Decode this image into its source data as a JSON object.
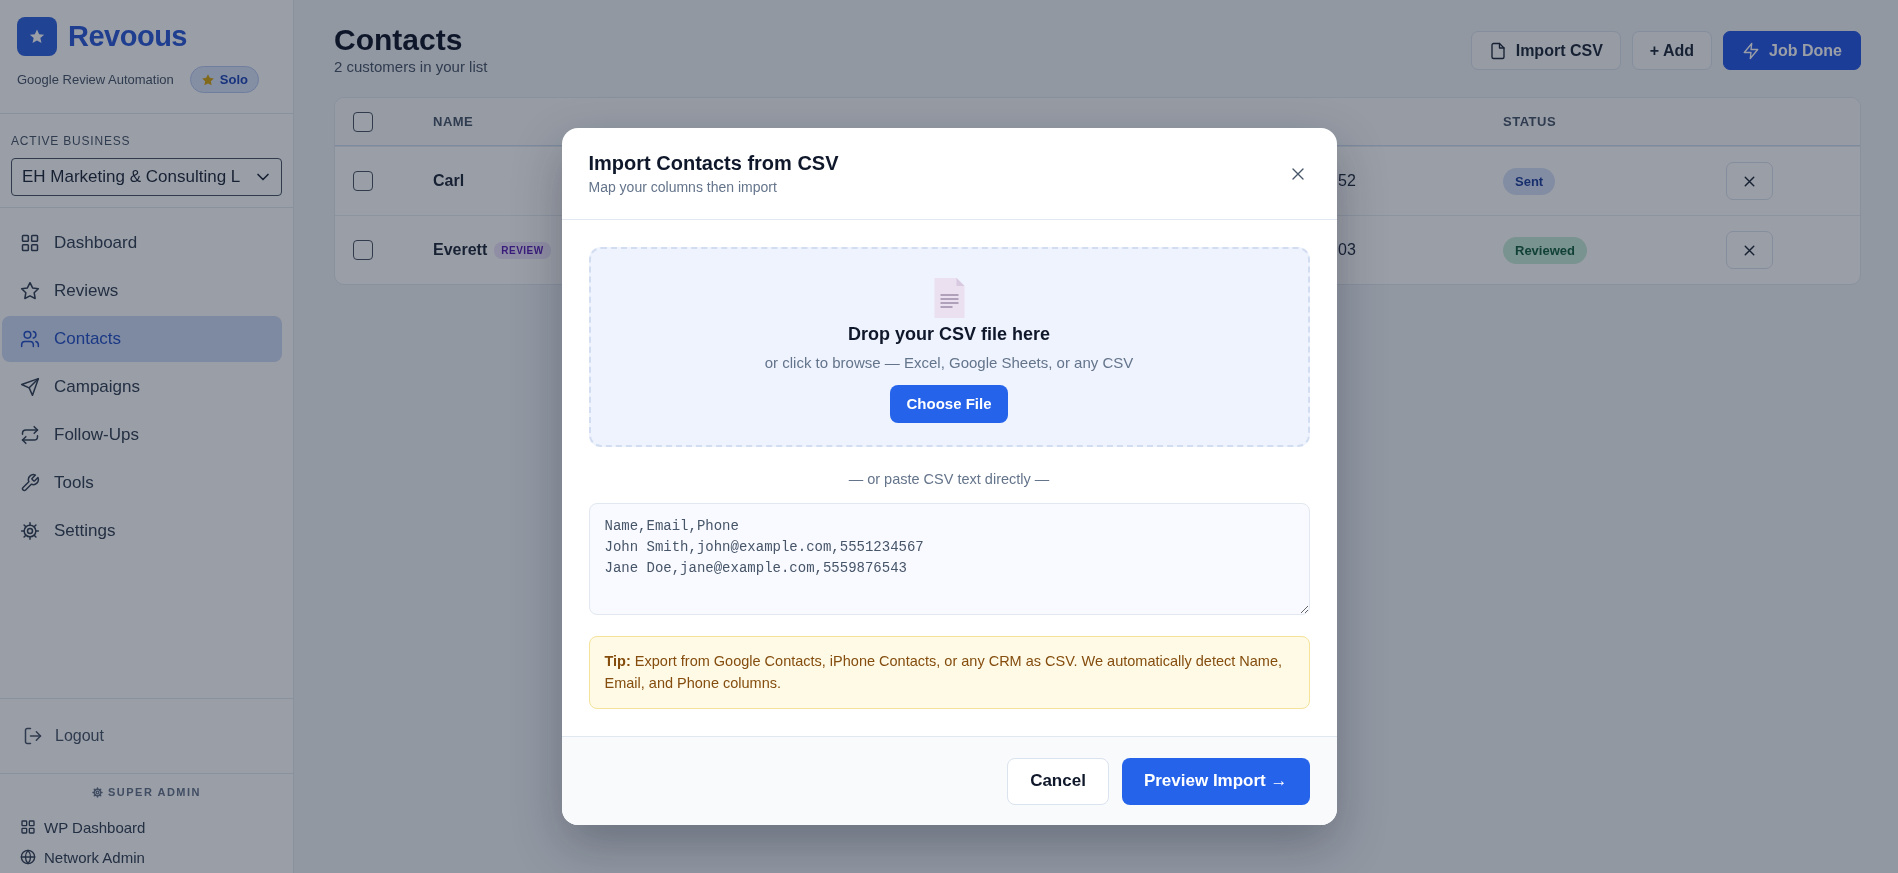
{
  "sidebar": {
    "brand": "Revoous",
    "tagline": "Google Review Automation",
    "plan_badge": "Solo",
    "business_label": "ACTIVE BUSINESS",
    "business_select": "EH Marketing & Consulting L",
    "nav": [
      {
        "label": "Dashboard",
        "kind": "grid",
        "selected": false
      },
      {
        "label": "Reviews",
        "kind": "star",
        "selected": false
      },
      {
        "label": "Contacts",
        "kind": "users",
        "selected": true
      },
      {
        "label": "Campaigns",
        "kind": "send",
        "selected": false
      },
      {
        "label": "Follow-Ups",
        "kind": "repeat",
        "selected": false
      },
      {
        "label": "Tools",
        "kind": "wrench",
        "selected": false
      },
      {
        "label": "Settings",
        "kind": "gear",
        "selected": false
      }
    ],
    "logout": "Logout",
    "admin_heading": "SUPER ADMIN",
    "admin_items": [
      {
        "label": "WP Dashboard",
        "kind": "grid"
      },
      {
        "label": "Network Admin",
        "kind": "globe"
      }
    ]
  },
  "page": {
    "title": "Contacts",
    "subtitle": "2 customers in your list",
    "actions": [
      {
        "label": "Import CSV",
        "kind": "import"
      },
      {
        "label": "+ Add",
        "kind": "add"
      },
      {
        "label": "Job Done",
        "kind": "job"
      }
    ]
  },
  "table": {
    "select_all_checked": false,
    "columns": [
      {
        "label": "NAME"
      },
      {
        "label": "STATUS"
      }
    ],
    "rows": [
      {
        "checked": false,
        "name": "Carl",
        "phone": "52",
        "status": "Sent",
        "kind": "sent"
      },
      {
        "checked": false,
        "name": "Everett",
        "badge": "REVIEW",
        "phone": "03",
        "status": "Reviewed",
        "kind": "reviewed"
      }
    ]
  },
  "modal": {
    "title": "Import Contacts from CSV",
    "subtitle": "Map your columns then import",
    "drop_title": "Drop your CSV file here",
    "drop_hint": "or click to browse — Excel, Google Sheets, or any CSV",
    "choose_button": "Choose File",
    "separator": "— or paste CSV text directly —",
    "csv_text": "Name,Email,Phone\nJohn Smith,john@example.com,5551234567\nJane Doe,jane@example.com,5559876543",
    "tip": "**Tip:** Export from Google Contacts, iPhone Contacts, or any CRM as CSV. We automatically detect Name, Email, and Phone columns.",
    "cancel_button": "Cancel",
    "preview_button": "Preview Import →"
  }
}
